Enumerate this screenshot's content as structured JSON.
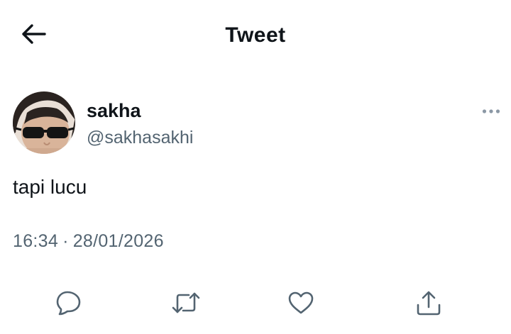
{
  "header": {
    "title": "Tweet",
    "back_icon": "arrow-left-icon"
  },
  "tweet": {
    "author": {
      "display_name": "sakha",
      "handle": "@sakhasakhi"
    },
    "text": "tapi lucu",
    "time": "16:34",
    "separator": "·",
    "date": "28/01/2026",
    "more_icon": "more-horizontal-icon"
  },
  "actions": [
    {
      "name": "reply",
      "icon": "reply-icon"
    },
    {
      "name": "retweet",
      "icon": "retweet-icon"
    },
    {
      "name": "like",
      "icon": "heart-icon"
    },
    {
      "name": "share",
      "icon": "share-icon"
    }
  ],
  "colors": {
    "text_primary": "#0f1419",
    "text_secondary": "#536471",
    "icon": "#536471",
    "background": "#ffffff"
  }
}
